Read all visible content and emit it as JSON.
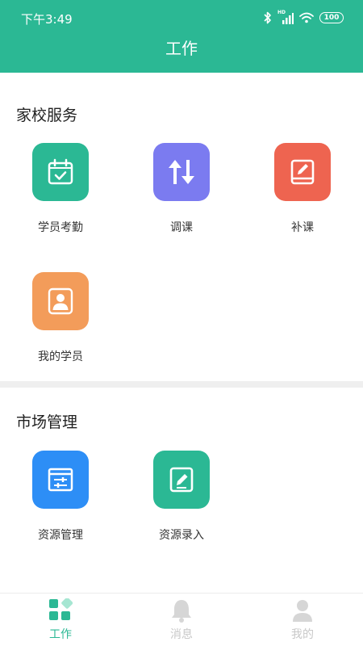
{
  "status_bar": {
    "time": "下午3:49",
    "network_label": "HD",
    "battery": "100"
  },
  "header": {
    "title": "工作"
  },
  "sections": [
    {
      "title": "家校服务",
      "items": [
        {
          "label": "学员考勤",
          "icon": "calendar-check-icon",
          "color": "#2bb894"
        },
        {
          "label": "调课",
          "icon": "swap-vertical-icon",
          "color": "#7b7bf0"
        },
        {
          "label": "补课",
          "icon": "book-edit-icon",
          "color": "#ee6450"
        },
        {
          "label": "我的学员",
          "icon": "user-icon",
          "color": "#f39c5a"
        }
      ]
    },
    {
      "title": "市场管理",
      "items": [
        {
          "label": "资源管理",
          "icon": "sliders-icon",
          "color": "#2d8ef6"
        },
        {
          "label": "资源录入",
          "icon": "edit-icon",
          "color": "#2bb894"
        }
      ]
    }
  ],
  "tabbar": {
    "items": [
      {
        "label": "工作",
        "icon": "grid-icon",
        "active": true
      },
      {
        "label": "消息",
        "icon": "bell-icon",
        "active": false
      },
      {
        "label": "我的",
        "icon": "person-icon",
        "active": false
      }
    ]
  },
  "colors": {
    "primary": "#2bb894",
    "inactive": "#c8c8c8"
  }
}
